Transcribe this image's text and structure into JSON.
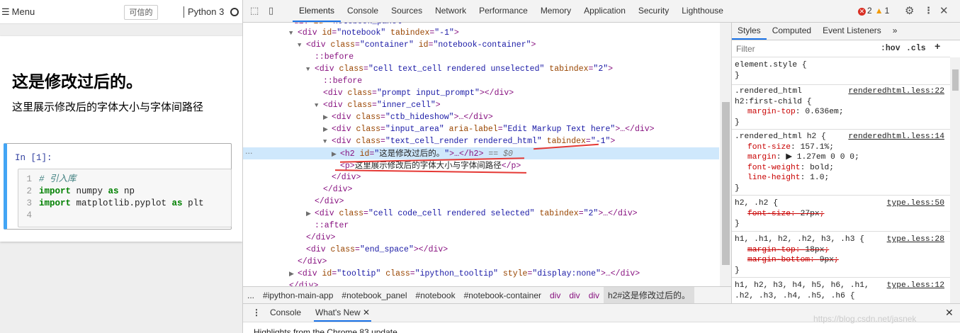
{
  "jupyter": {
    "menu_label": "Menu",
    "trusted_label": "可信的",
    "kernel_name": "Python 3",
    "markdown": {
      "heading": "这是修改过后的。",
      "paragraph": "这里展示修改后的字体大小与字体间路径"
    },
    "code_cell": {
      "prompt": "In  [1]:",
      "lines": [
        {
          "num": "1",
          "comment": "# 引入库"
        },
        {
          "num": "2",
          "kw1": "import",
          "mid": " numpy ",
          "kw2": "as",
          "tail": " np"
        },
        {
          "num": "3",
          "kw1": "import",
          "mid": " matplotlib.pyplot ",
          "kw2": "as",
          "tail": " plt"
        },
        {
          "num": "4"
        }
      ]
    }
  },
  "devtools": {
    "tabs": [
      "Elements",
      "Console",
      "Sources",
      "Network",
      "Performance",
      "Memory",
      "Application",
      "Security",
      "Lighthouse"
    ],
    "active_tab": "Elements",
    "error_count": "2",
    "warning_count": "1",
    "selected_h2_text": "这是修改过后的。",
    "selected_suffix": "== $0",
    "p_text": "这里展示修改后的字体大小与字体间路径",
    "breadcrumbs": [
      "...",
      "#ipython-main-app",
      "#notebook_panel",
      "#notebook",
      "#notebook-container",
      "div",
      "div",
      "div",
      "h2#这是修改过后的。"
    ],
    "styles": {
      "tabs": [
        "Styles",
        "Computed",
        "Event Listeners"
      ],
      "filter_placeholder": "Filter",
      "hov": ":hov",
      "cls": ".cls",
      "rules": [
        {
          "selector": "element.style {",
          "source": ""
        },
        {
          "selector": ".rendered_html",
          "selector2": "h2:first-child {",
          "source": "renderedhtml.less:22"
        },
        {
          "selector": ".rendered_html h2 {",
          "source": "renderedhtml.less:14"
        },
        {
          "selector": "h2, .h2 {",
          "source": "type.less:50"
        },
        {
          "selector": "h1, .h1, h2, .h2, h3, .h3 {",
          "source": "type.less:28"
        },
        {
          "selector": "h1, h2, h3, h4, h5, h6, .h1,",
          "selector2": ".h2, .h3, .h4, .h5, .h6 {",
          "source": "type.less:12"
        }
      ]
    },
    "drawer": {
      "tabs": [
        "Console",
        "What's New"
      ],
      "active_tab": "What's New",
      "highlight_text": "Highlights from the Chrome 83 update"
    }
  },
  "watermark": "https://blog.csdn.net/jasnek"
}
